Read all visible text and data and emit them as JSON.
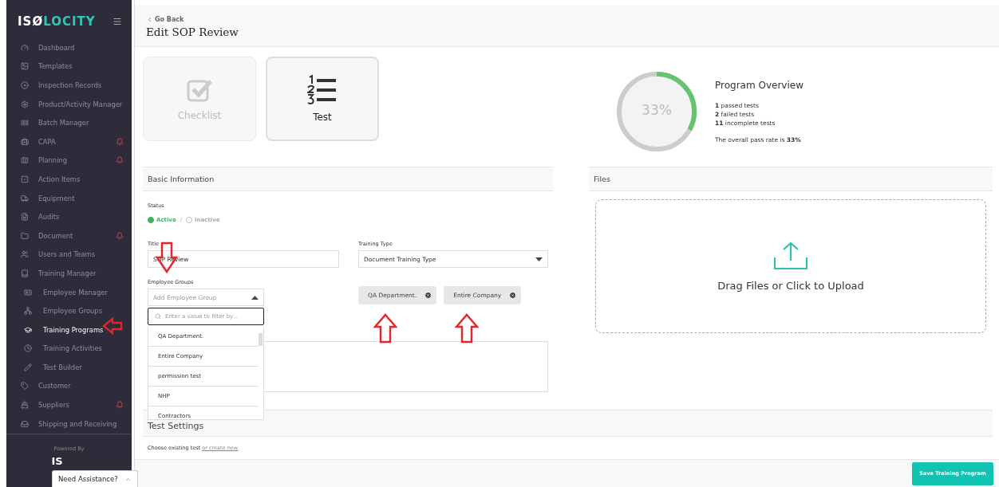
{
  "sidebar": {
    "logo": {
      "prefix": "ISØ",
      "suffix": "LOCITY"
    },
    "items": [
      {
        "label": "Dashboard",
        "alert": false,
        "selected": false
      },
      {
        "label": "Templates",
        "alert": false,
        "selected": false
      },
      {
        "label": "Inspection Records",
        "alert": false,
        "selected": false
      },
      {
        "label": "Product/Activity Manager",
        "alert": false,
        "selected": false
      },
      {
        "label": "Batch Manager",
        "alert": false,
        "selected": false
      },
      {
        "label": "CAPA",
        "alert": true,
        "selected": false
      },
      {
        "label": "Planning",
        "alert": true,
        "selected": false
      },
      {
        "label": "Action Items",
        "alert": false,
        "selected": false
      },
      {
        "label": "Equipment",
        "alert": false,
        "selected": false
      },
      {
        "label": "Audits",
        "alert": false,
        "selected": false
      },
      {
        "label": "Document",
        "alert": true,
        "selected": false
      },
      {
        "label": "Users and Teams",
        "alert": false,
        "selected": false
      },
      {
        "label": "Training Manager",
        "alert": false,
        "selected": false,
        "children": [
          {
            "label": "Employee Manager",
            "alert": false,
            "selected": false
          },
          {
            "label": "Employee Groups",
            "alert": false,
            "selected": false
          },
          {
            "label": "Training Programs",
            "alert": false,
            "selected": true
          },
          {
            "label": "Training Activities",
            "alert": false,
            "selected": false
          },
          {
            "label": "Test Builder",
            "alert": false,
            "selected": false
          }
        ]
      },
      {
        "label": "Customer",
        "alert": false,
        "selected": false
      },
      {
        "label": "Suppliers",
        "alert": true,
        "selected": false
      },
      {
        "label": "Shipping and Receiving",
        "alert": false,
        "selected": false
      }
    ],
    "powered_by": "Powered By",
    "footer_logo": "IS"
  },
  "header": {
    "back": "Go Back",
    "title": "Edit SOP Review"
  },
  "program_types": [
    {
      "label": "Checklist",
      "kind": "checklist",
      "selected": false
    },
    {
      "label": "Test",
      "kind": "test",
      "selected": true
    }
  ],
  "overview": {
    "title": "Program Overview",
    "level": 0.33,
    "reading": "33%",
    "stats": [
      "**1** passed tests",
      "**2** failed tests",
      "**11** incomplete tests"
    ],
    "summary": "The overall pass rate is **33%**"
  },
  "basic_information": {
    "heading": "Basic Information",
    "status_label": "Status",
    "status_options": [
      {
        "label": "Active",
        "selected": true
      },
      {
        "label": "Inactive",
        "selected": false
      }
    ],
    "status_separator": "/",
    "title_label": "Title",
    "title_value": "SOP Review",
    "training_type_label": "Training Type",
    "training_type_value": "Document Training Type",
    "groups_label": "Employee Groups",
    "groups_placeholder": "Add Employee Group",
    "filter_placeholder": "Enter a value to filter by...",
    "group_options": [
      "QA Department.",
      "Entire Company",
      "permission test",
      "NHP",
      "Contractors"
    ],
    "selected_groups": [
      "QA Department.",
      "Entire Company"
    ]
  },
  "files": {
    "heading": "Files",
    "upload": "Drag Files or Click to Upload"
  },
  "test_settings": {
    "heading": "Test Settings",
    "text": "Choose existing test",
    "link": "or create new"
  },
  "save_button": "Save Training Program",
  "help": "Need Assistance?"
}
